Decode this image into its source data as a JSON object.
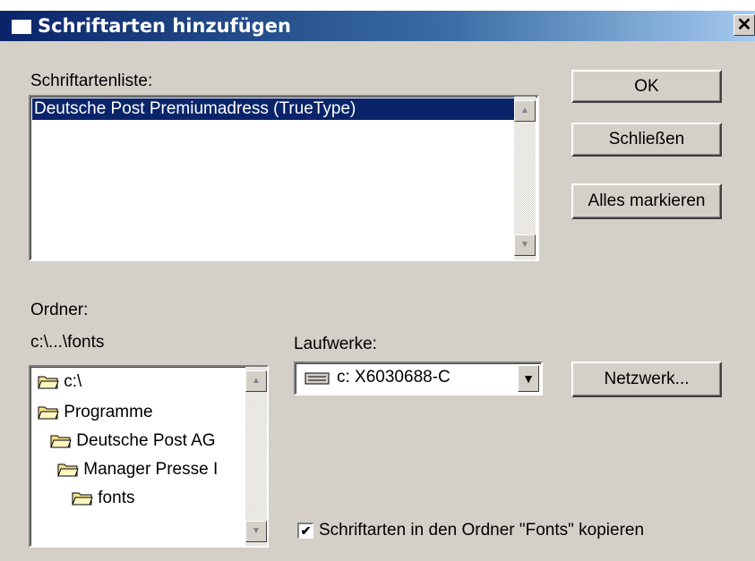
{
  "window": {
    "title": "Schriftarten hinzufügen",
    "close_glyph": "✕"
  },
  "fontlist": {
    "label": "Schriftartenliste:",
    "items": [
      "Deutsche Post Premiumadress (TrueType)"
    ]
  },
  "buttons": {
    "ok": "OK",
    "close": "Schließen",
    "select_all": "Alles markieren",
    "network": "Netzwerk..."
  },
  "folder": {
    "label": "Ordner:",
    "path": "c:\\...\\fonts",
    "tree": [
      "c:\\",
      "Programme",
      "Deutsche Post AG",
      "Manager Presse I",
      "fonts"
    ]
  },
  "drives": {
    "label": "Laufwerke:",
    "selected": "c: X6030688-C"
  },
  "copy_option": {
    "label": "Schriftarten in den Ordner \"Fonts\" kopieren",
    "checked": true
  },
  "icons": [
    "window-icon",
    "close-icon",
    "folder-open-icon",
    "drive-icon",
    "scroll-up-icon",
    "scroll-down-icon",
    "dropdown-arrow-icon",
    "checkmark-icon"
  ]
}
